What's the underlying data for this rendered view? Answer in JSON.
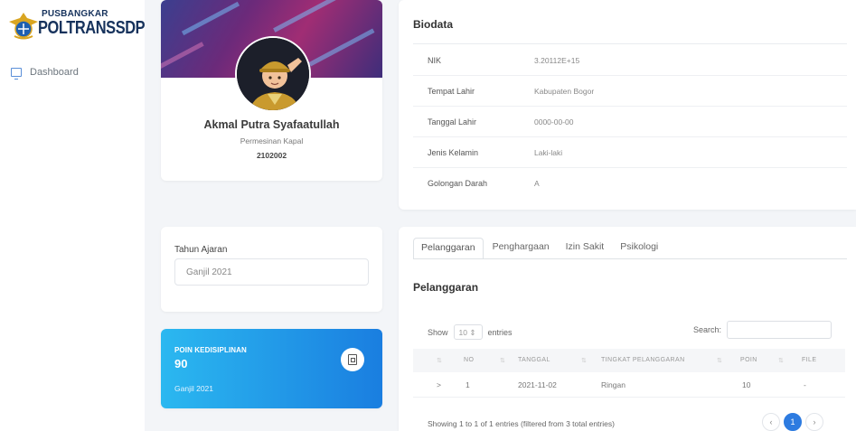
{
  "logo": {
    "top_text": "PUSBANGKAR",
    "main_text": "POLTRANSSDP"
  },
  "sidebar": {
    "items": [
      {
        "label": "Dashboard",
        "icon": "monitor-icon"
      }
    ]
  },
  "profile": {
    "name": "Akmal Putra Syafaatullah",
    "department": "Permesinan Kapal",
    "student_id": "2102002"
  },
  "biodata": {
    "title": "Biodata",
    "rows": [
      {
        "label": "NIK",
        "value": "3.20112E+15"
      },
      {
        "label": "Tempat Lahir",
        "value": "Kabupaten Bogor"
      },
      {
        "label": "Tanggal Lahir",
        "value": "0000-00-00"
      },
      {
        "label": "Jenis Kelamin",
        "value": "Laki-laki"
      },
      {
        "label": "Golongan Darah",
        "value": "A"
      }
    ]
  },
  "tahun": {
    "label": "Tahun Ajaran",
    "selected": "Ganjil 2021"
  },
  "poin": {
    "label": "POIN KEDISIPLINAN",
    "value": "90",
    "semester": "Ganjil 2021",
    "icon": "notebook-icon"
  },
  "tabs": [
    {
      "label": "Pelanggaran",
      "active": true
    },
    {
      "label": "Penghargaan",
      "active": false
    },
    {
      "label": "Izin Sakit",
      "active": false
    },
    {
      "label": "Psikologi",
      "active": false
    }
  ],
  "section_title": "Pelanggaran",
  "table_controls": {
    "show_label": "Show",
    "entries_value": "10",
    "entries_label": "entries",
    "search_label": "Search:"
  },
  "table": {
    "headers": [
      "NO",
      "TANGGAL",
      "TINGKAT PELANGGARAN",
      "POIN",
      "FILE"
    ],
    "rows": [
      {
        "expand": ">",
        "no": "1",
        "tanggal": "2021-11-02",
        "tingkat": "Ringan",
        "poin": "10",
        "file": "-"
      }
    ]
  },
  "info": "Showing 1 to 1 of 1 entries (filtered from 3 total entries)",
  "pager": {
    "prev": "‹",
    "current": "1",
    "next": "›"
  },
  "colors": {
    "accent": "#2d7be0",
    "poin_gradient_start": "#2bb8f0",
    "poin_gradient_end": "#1a7ee0",
    "brand_navy": "#16325c"
  }
}
